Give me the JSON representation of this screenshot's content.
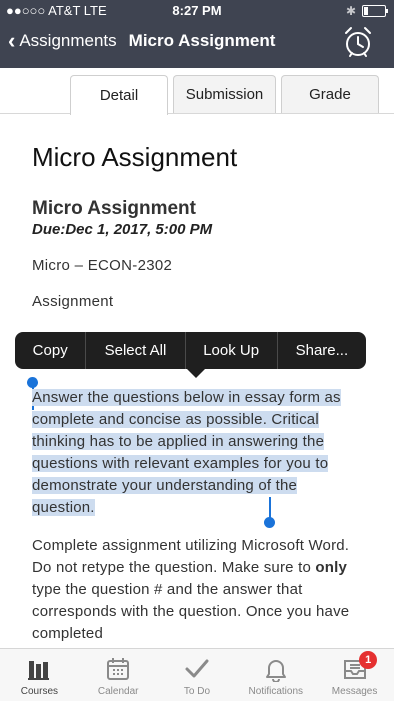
{
  "status_bar": {
    "carrier": "●●○○○ AT&T  LTE",
    "time": "8:27 PM",
    "bluetooth": "✱",
    "battery_level": 0.2
  },
  "nav": {
    "back_label": "Assignments",
    "title": "Micro Assignment",
    "right_icon": "alarm-clock-icon"
  },
  "tabs": [
    {
      "label": "Detail",
      "active": true
    },
    {
      "label": "Submission",
      "active": false
    },
    {
      "label": "Grade",
      "active": false
    }
  ],
  "content": {
    "title": "Micro Assignment",
    "subtitle": "Micro Assignment",
    "due": "Due:Dec 1, 2017, 5:00 PM",
    "course": "Micro – ECON-2302",
    "type": "Assignment",
    "paragraph1": "Answer the questions below in essay form as complete and concise as possible. Critical thinking has to be applied in answering the questions with relevant examples for you to demonstrate your understanding of the question.",
    "paragraph2_a": "Complete assignment utilizing Microsoft Word. Do not retype the question. Make sure to ",
    "paragraph2_bold": "only",
    "paragraph2_b": " type the question # and the answer that corresponds with the question. Once you have completed"
  },
  "context_menu": {
    "copy": "Copy",
    "select_all": "Select All",
    "look_up": "Look Up",
    "share": "Share..."
  },
  "bottom_tabs": [
    {
      "label": "Courses",
      "icon": "courses-icon",
      "active": true
    },
    {
      "label": "Calendar",
      "icon": "calendar-icon",
      "active": false
    },
    {
      "label": "To Do",
      "icon": "checkmark-icon",
      "active": false
    },
    {
      "label": "Notifications",
      "icon": "bell-icon",
      "active": false
    },
    {
      "label": "Messages",
      "icon": "inbox-icon",
      "active": false,
      "badge": "1"
    }
  ],
  "colors": {
    "header_bg": "#3f4451",
    "selection": "#cddcef",
    "handle": "#1a73d9",
    "badge": "#e53030"
  }
}
